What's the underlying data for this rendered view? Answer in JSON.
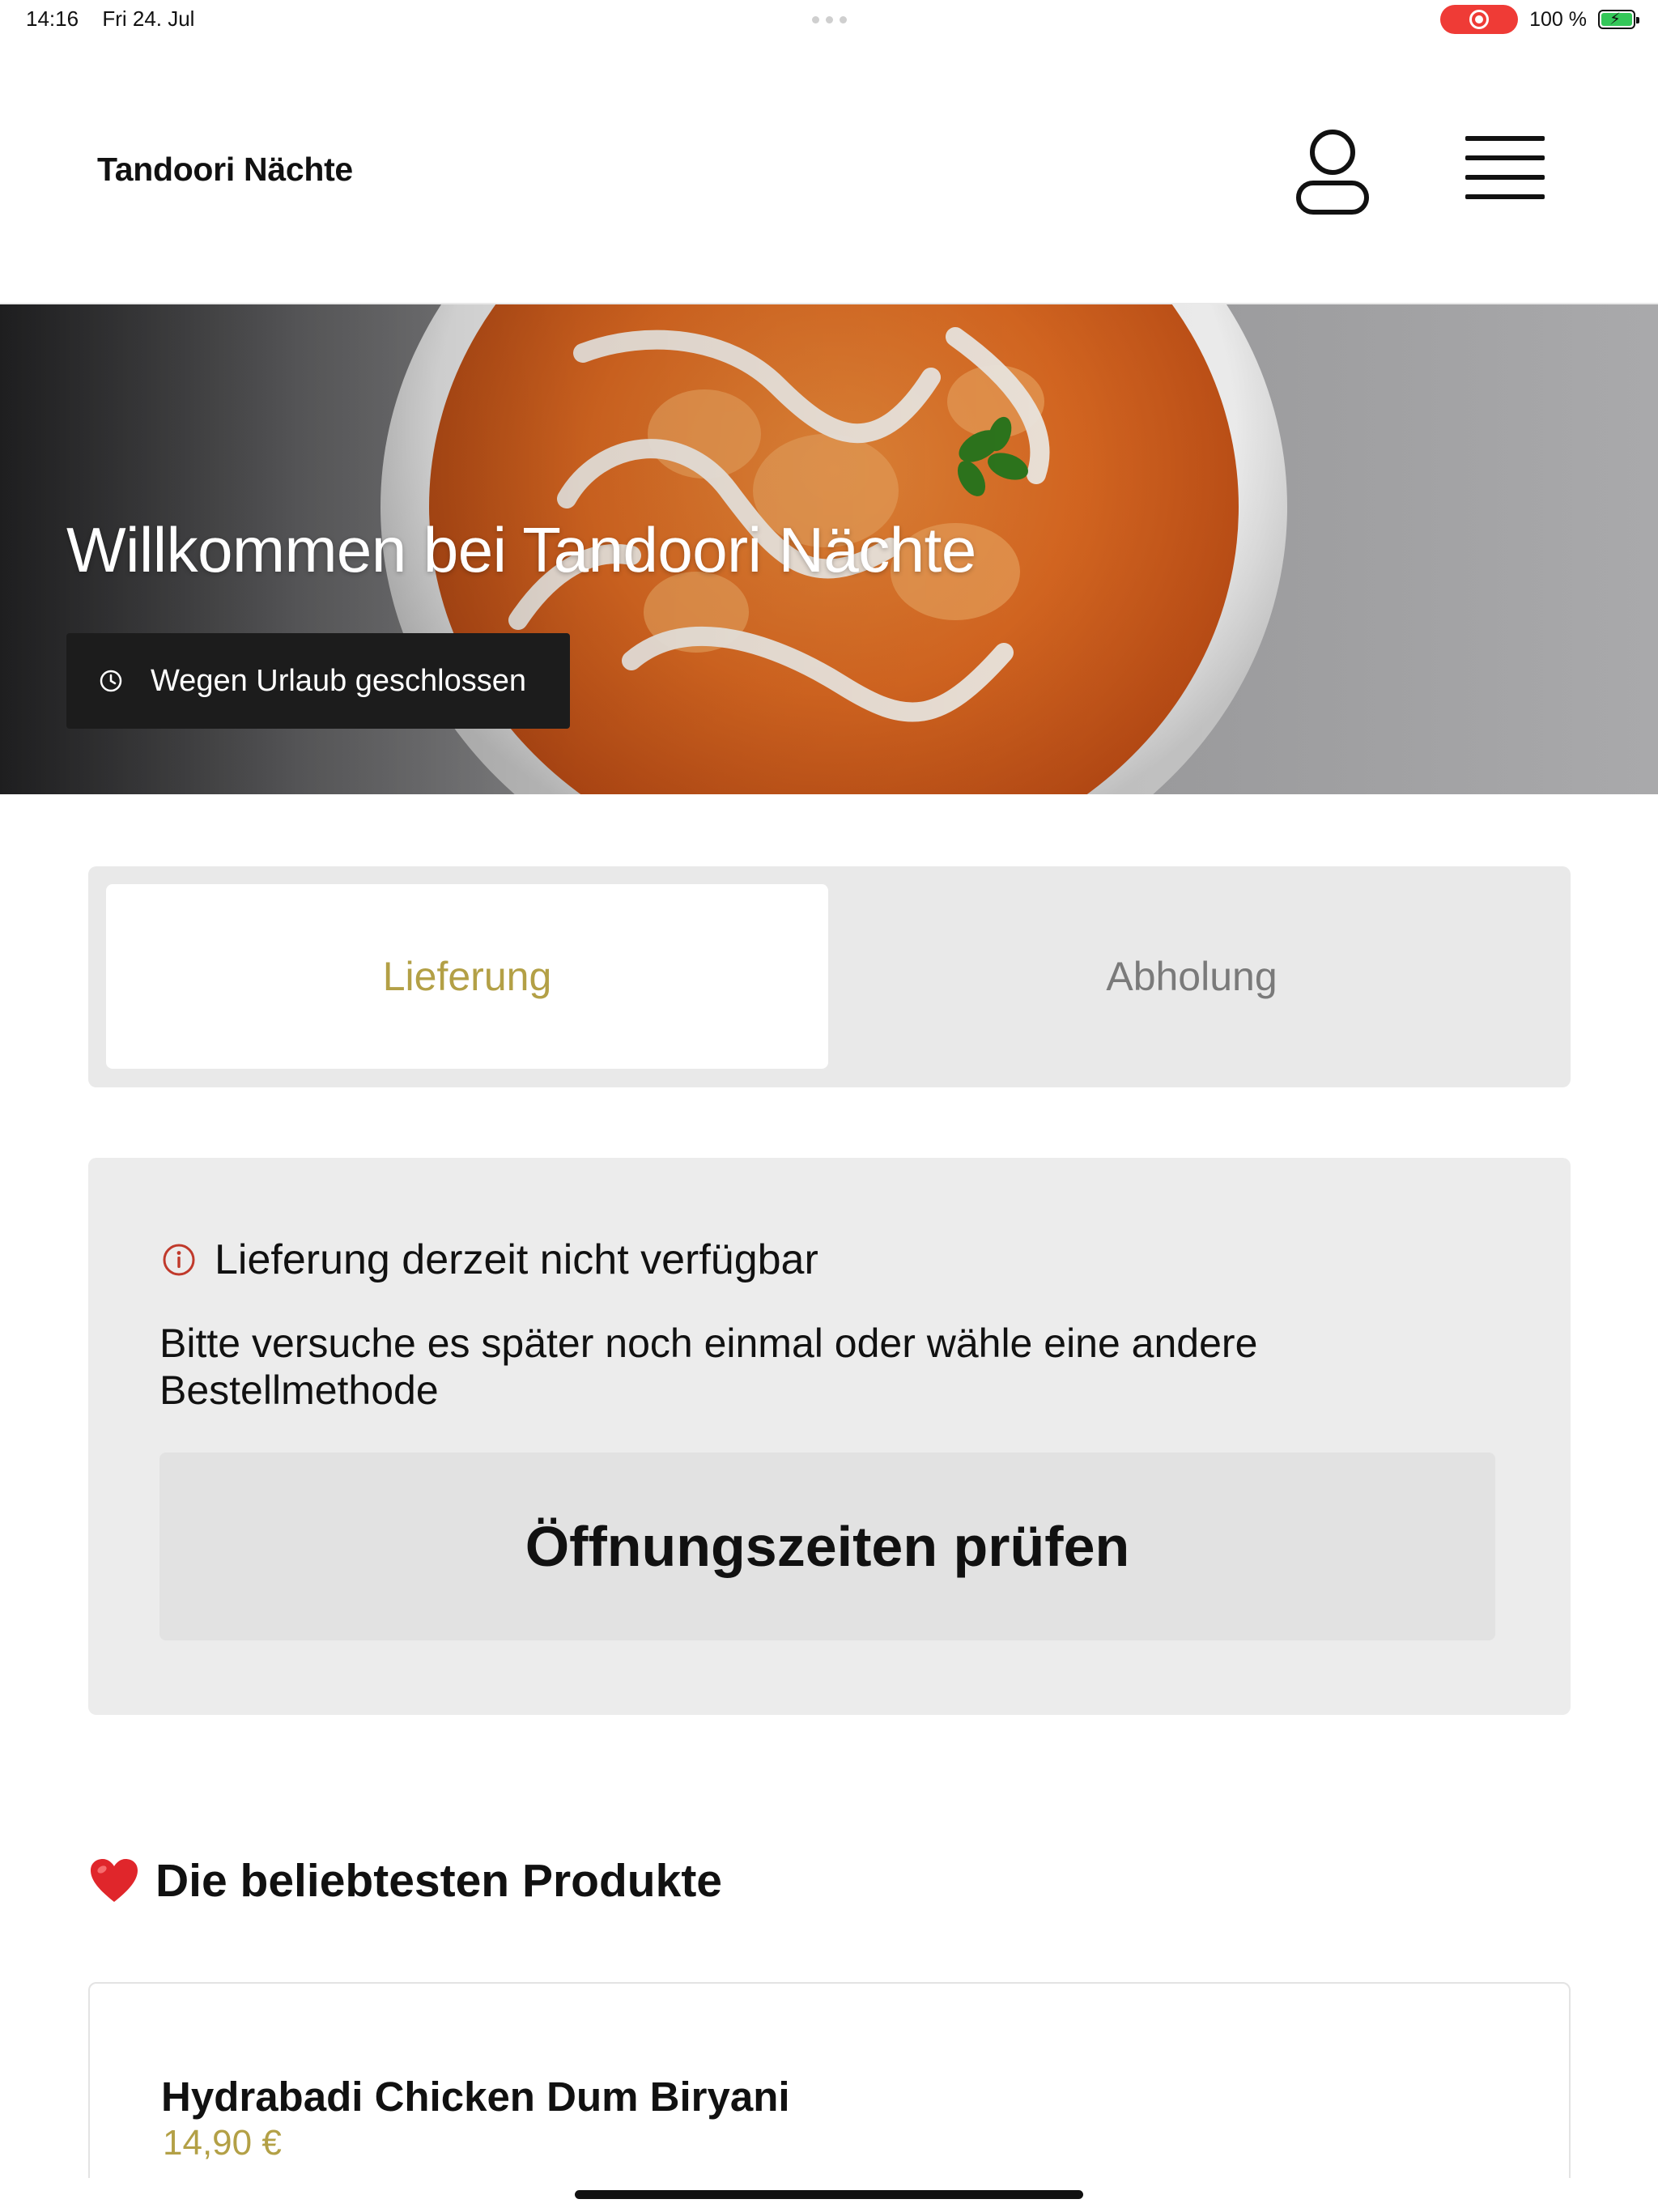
{
  "status_bar": {
    "time": "14:16",
    "date": "Fri 24. Jul",
    "battery_percent": "100 %",
    "battery_level": 1.0,
    "recording_color": "#ef3b36",
    "battery_color": "#34c759"
  },
  "header": {
    "brand": "Tandoori Nächte",
    "user_icon": "user-icon",
    "menu_icon": "hamburger-menu-icon"
  },
  "hero": {
    "title": "Willkommen bei Tandoori Nächte",
    "status_icon": "clock-icon",
    "status_label": "Wegen Urlaub geschlossen"
  },
  "order_toggle": {
    "options": [
      "Lieferung",
      "Abholung"
    ],
    "selected": "Lieferung",
    "accent_color": "#b3a046"
  },
  "notice": {
    "icon": "info-circle-icon",
    "icon_color": "#c0392b",
    "title": "Lieferung derzeit nicht verfügbar",
    "message": "Bitte versuche es später noch einmal oder wähle eine andere Bestellmethode",
    "button_label": "Öffnungszeiten prüfen"
  },
  "popular": {
    "icon": "red-heart-icon",
    "heading": "Die beliebtesten Produkte",
    "products": [
      {
        "name": "Hydrabadi Chicken Dum Biryani",
        "price": "14,90 €"
      }
    ]
  }
}
